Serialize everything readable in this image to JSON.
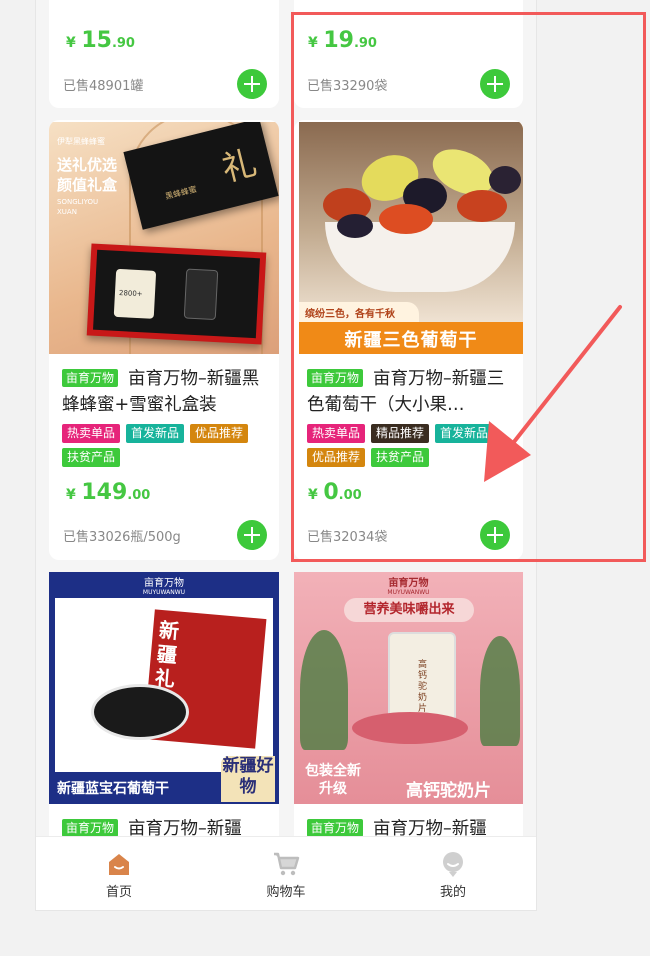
{
  "products": [
    {
      "currency": "¥",
      "price_int": "15",
      "price_dec": ".90",
      "sold": "已售48901罐"
    },
    {
      "currency": "¥",
      "price_int": "19",
      "price_dec": ".90",
      "sold": "已售33290袋"
    },
    {
      "brand": "亩育万物",
      "title": "亩育万物–新疆黑蜂蜂蜜+雪蜜礼盒装",
      "tags": [
        "热卖单品",
        "首发新品",
        "优品推荐",
        "扶贫产品"
      ],
      "currency": "¥",
      "price_int": "149",
      "price_dec": ".00",
      "sold": "已售33026瓶/500g",
      "image_text": {
        "l1": "伊犁黑蜂蜂蜜",
        "l2": "送礼优选",
        "l3": "颜值礼盒",
        "l4": "SONGLIYOU",
        "l5": "XUAN",
        "box": "礼",
        "box_sub": "黑蜂蜂蜜",
        "jar": "2800+"
      }
    },
    {
      "brand": "亩育万物",
      "title": "亩育万物–新疆三色葡萄干（大小果…",
      "tags": [
        "热卖单品",
        "精品推荐",
        "首发新品",
        "优品推荐",
        "扶贫产品"
      ],
      "currency": "¥",
      "price_int": "0",
      "price_dec": ".00",
      "sold": "已售32034袋",
      "image_text": {
        "ribbon": "缤纷三色，各有千秋",
        "banner": "新疆三色葡萄干"
      }
    },
    {
      "brand": "亩育万物",
      "title": "亩育万物–新疆",
      "image_text": {
        "logo": "亩育万物",
        "logo_sub": "MUYUWANWU",
        "pack": "新疆礼",
        "caption": "新疆蓝宝石葡萄干",
        "badge": "新疆好物"
      }
    },
    {
      "brand": "亩育万物",
      "title": "亩育万物–新疆",
      "image_text": {
        "logo": "亩育万物",
        "logo_sub": "MUYUWANWU",
        "banner": "营养美味嚼出来",
        "jar": "高钙驼奶片",
        "left": "包装全新升级",
        "right": "高钙驼奶片"
      }
    }
  ],
  "tag_colors": {
    "热卖单品": "#e6247a",
    "首发新品": "#17b39b",
    "优品推荐": "#d4860e",
    "扶贫产品": "#3dc93b",
    "精品推荐": "#3a2c20"
  },
  "nav": [
    {
      "label": "首页",
      "icon": "home-icon"
    },
    {
      "label": "购物车",
      "icon": "cart-icon"
    },
    {
      "label": "我的",
      "icon": "profile-icon"
    }
  ],
  "colors": {
    "accent": "#3dc93b",
    "highlight": "#f25a5a"
  }
}
